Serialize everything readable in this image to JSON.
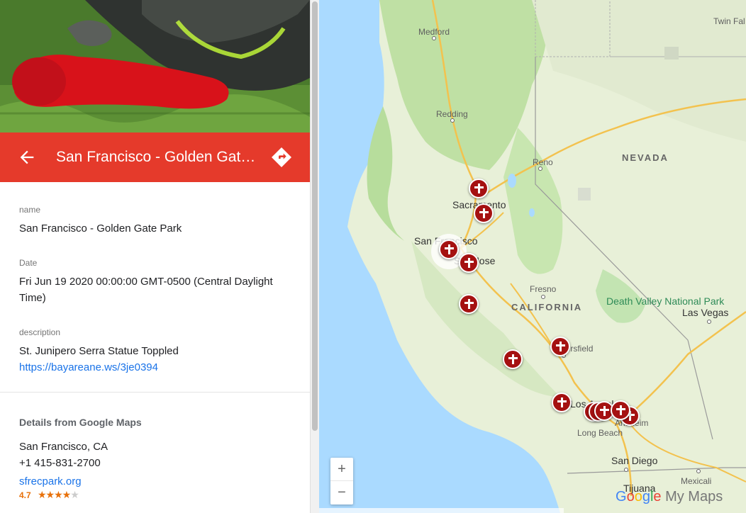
{
  "place": {
    "title": "San Francisco - Golden Gate Park",
    "photo_alt": "statue-photo"
  },
  "fields": {
    "name_label": "name",
    "name_value": "San Francisco - Golden Gate Park",
    "date_label": "Date",
    "date_value": "Fri Jun 19 2020 00:00:00 GMT-0500 (Central Daylight Time)",
    "description_label": "description",
    "description_value": "St. Junipero Serra Statue Toppled",
    "description_link": "https://bayareane.ws/3je0394"
  },
  "google_details": {
    "heading": "Details from Google Maps",
    "city": "San Francisco, CA",
    "phone": "+1 415-831-2700",
    "website": "sfrecpark.org",
    "rating": "4.7",
    "stars": "★★★★",
    "half_star": "★"
  },
  "map": {
    "labels": {
      "medford": "Medford",
      "twin_falls": "Twin Fal",
      "redding": "Redding",
      "reno": "Reno",
      "nevada": "NEVADA",
      "sacramento": "Sacramento",
      "san_francisco": "San Francisco",
      "san_jose": "San Jose",
      "fresno": "Fresno",
      "california": "CALIFORNIA",
      "death_valley": "Death Valley National Park",
      "las_vegas": "Las Vegas",
      "bakersfield": "Bakersfield",
      "los_angeles": "Los Angeles",
      "anaheim": "Anaheim",
      "long_beach": "Long Beach",
      "san_diego": "San Diego",
      "tijuana": "Tijuana",
      "mexicali": "Mexicali"
    },
    "zoom_in": "+",
    "zoom_out": "−",
    "brand": {
      "g1": "G",
      "g2": "o",
      "g3": "o",
      "g4": "g",
      "g5": "l",
      "g6": "e",
      "my_maps": " My Maps"
    },
    "colors": {
      "water": "#aadaff",
      "land": "#e8f0d8",
      "marker": "#a51111",
      "header": "#e53a2b"
    }
  }
}
